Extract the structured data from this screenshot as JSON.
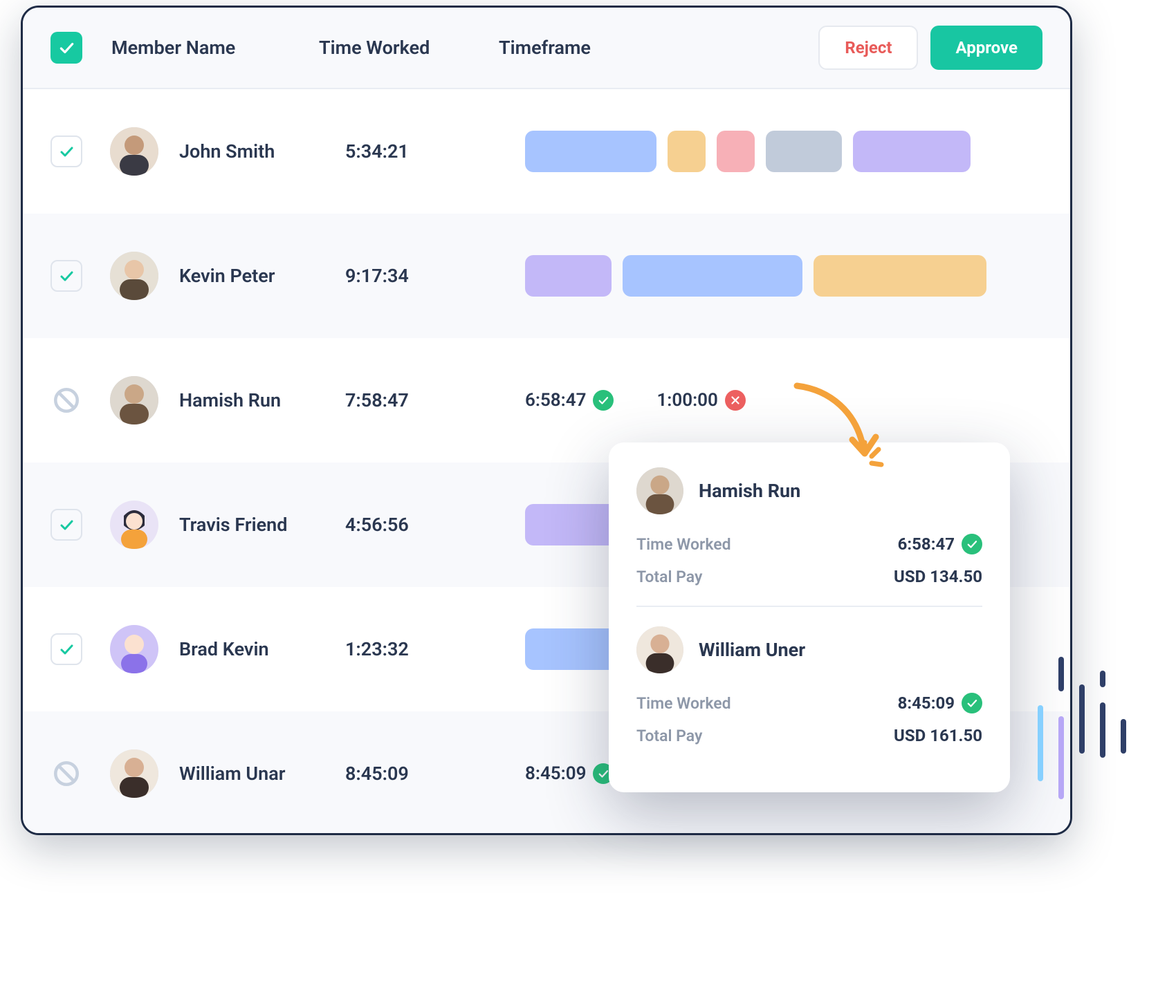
{
  "header": {
    "col_name": "Member Name",
    "col_time": "Time Worked",
    "col_tf": "Timeframe",
    "reject": "Reject",
    "approve": "Approve"
  },
  "rows": [
    {
      "name": "John Smith",
      "time": "5:34:21"
    },
    {
      "name": "Kevin Peter",
      "time": "9:17:34"
    },
    {
      "name": "Hamish Run",
      "time": "7:58:47",
      "detail": {
        "ok": "6:58:47",
        "no": "1:00:00"
      }
    },
    {
      "name": "Travis Friend",
      "time": "4:56:56"
    },
    {
      "name": "Brad Kevin",
      "time": "1:23:32"
    },
    {
      "name": "William Unar",
      "time": "8:45:09",
      "detail": {
        "ok": "8:45:09"
      }
    }
  ],
  "popover": {
    "a": {
      "name": "Hamish Run",
      "time_label": "Time Worked",
      "time_value": "6:58:47",
      "pay_label": "Total Pay",
      "pay_value": "USD 134.50"
    },
    "b": {
      "name": "William Uner",
      "time_label": "Time Worked",
      "time_value": "8:45:09",
      "pay_label": "Total Pay",
      "pay_value": "USD 161.50"
    }
  }
}
